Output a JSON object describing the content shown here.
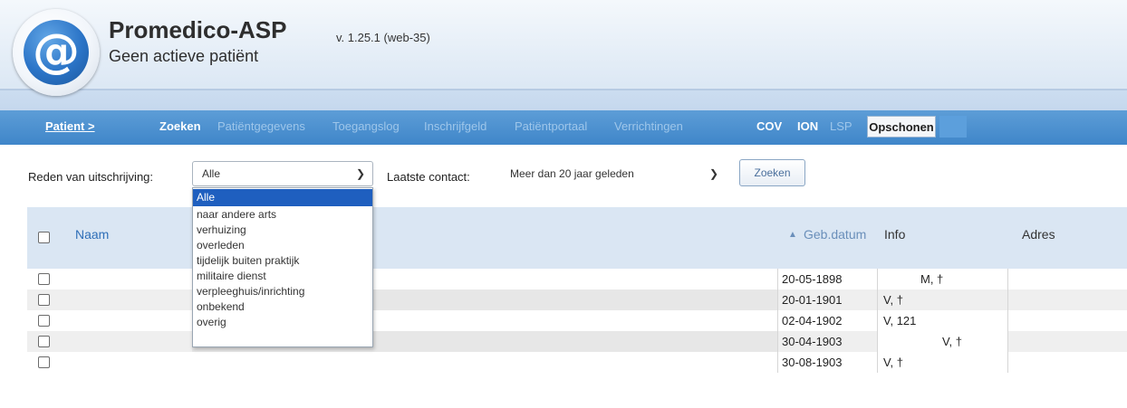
{
  "app": {
    "title": "Promedico-ASP",
    "version": "v. 1.25.1 (web-35)",
    "patient_status": "Geen actieve patiënt",
    "logo_glyph": "@"
  },
  "nav": {
    "patient_label": "Patient >",
    "items": [
      {
        "label": "Zoeken",
        "state": "enabled"
      },
      {
        "label": "Patiëntgegevens",
        "state": "disabled"
      },
      {
        "label": "Toegangslog",
        "state": "disabled"
      },
      {
        "label": "Inschrijfgeld",
        "state": "disabled"
      },
      {
        "label": "Patiëntportaal",
        "state": "disabled"
      },
      {
        "label": "Verrichtingen",
        "state": "disabled"
      },
      {
        "label": "COV",
        "state": "enabled"
      },
      {
        "label": "ION",
        "state": "enabled"
      },
      {
        "label": "LSP",
        "state": "disabled"
      },
      {
        "label": "Opschonen",
        "state": "active"
      }
    ]
  },
  "filters": {
    "reason_label": "Reden van uitschrijving:",
    "reason_value": "Alle",
    "contact_label": "Laatste contact:",
    "contact_value": "Meer dan 20 jaar geleden",
    "search_button": "Zoeken",
    "reason_options": [
      "Alle",
      "naar andere arts",
      "verhuizing",
      "overleden",
      "tijdelijk buiten praktijk",
      "militaire dienst",
      "verpleeghuis/inrichting",
      "onbekend",
      "overig"
    ]
  },
  "table": {
    "columns": {
      "name": "Naam",
      "birthdate": "Geb.datum",
      "sort_indicator": "▲",
      "info": "Info",
      "address": "Adres"
    },
    "rows": [
      {
        "birthdate": "20-05-1898",
        "info": "M, †"
      },
      {
        "birthdate": "20-01-1901",
        "info": "V, †"
      },
      {
        "birthdate": "02-04-1902",
        "info": "V, 121"
      },
      {
        "birthdate": "30-04-1903",
        "info": "V, †"
      },
      {
        "birthdate": "30-08-1903",
        "info": "V, †"
      }
    ]
  },
  "colors": {
    "nav_bar": "#3f86c9",
    "table_header": "#dae6f3",
    "dropdown_selected": "#1f5fbf"
  }
}
